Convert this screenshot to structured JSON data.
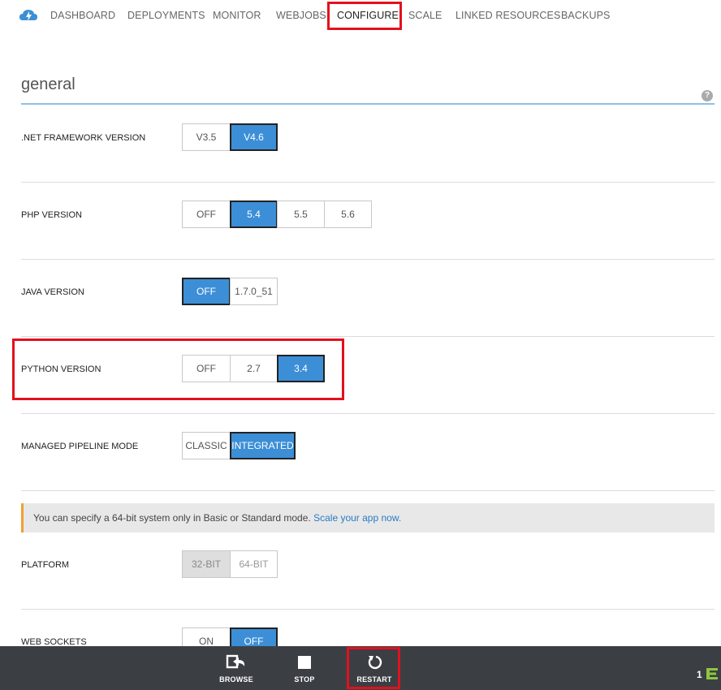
{
  "nav": {
    "items": [
      "DASHBOARD",
      "DEPLOYMENTS",
      "MONITOR",
      "WEBJOBS",
      "CONFIGURE",
      "SCALE",
      "LINKED RESOURCES",
      "BACKUPS"
    ],
    "active": "CONFIGURE"
  },
  "section": {
    "title": "general",
    "help": "?"
  },
  "settings": {
    "net": {
      "label": ".NET FRAMEWORK VERSION",
      "options": [
        "V3.5",
        "V4.6"
      ],
      "selected": "V4.6"
    },
    "php": {
      "label": "PHP VERSION",
      "options": [
        "OFF",
        "5.4",
        "5.5",
        "5.6"
      ],
      "selected": "5.4"
    },
    "java": {
      "label": "JAVA VERSION",
      "options": [
        "OFF",
        "1.7.0_51"
      ],
      "selected": "OFF"
    },
    "python": {
      "label": "PYTHON VERSION",
      "options": [
        "OFF",
        "2.7",
        "3.4"
      ],
      "selected": "3.4"
    },
    "pipeline": {
      "label": "MANAGED PIPELINE MODE",
      "options": [
        "CLASSIC",
        "INTEGRATED"
      ],
      "selected": "INTEGRATED"
    },
    "platform": {
      "label": "PLATFORM",
      "options": [
        "32-BIT",
        "64-BIT"
      ],
      "selected": "32-BIT"
    },
    "websockets": {
      "label": "WEB SOCKETS",
      "options": [
        "ON",
        "OFF"
      ],
      "selected": "OFF"
    }
  },
  "notice": {
    "text": "You can specify a 64-bit system only in Basic or Standard mode.",
    "link": "Scale your app now."
  },
  "bottombar": {
    "browse": "BROWSE",
    "stop": "STOP",
    "restart": "RESTART",
    "corner": "1"
  },
  "colors": {
    "accent": "#3c8fd6",
    "highlight": "#e3101e",
    "bar": "#3b3f44"
  }
}
